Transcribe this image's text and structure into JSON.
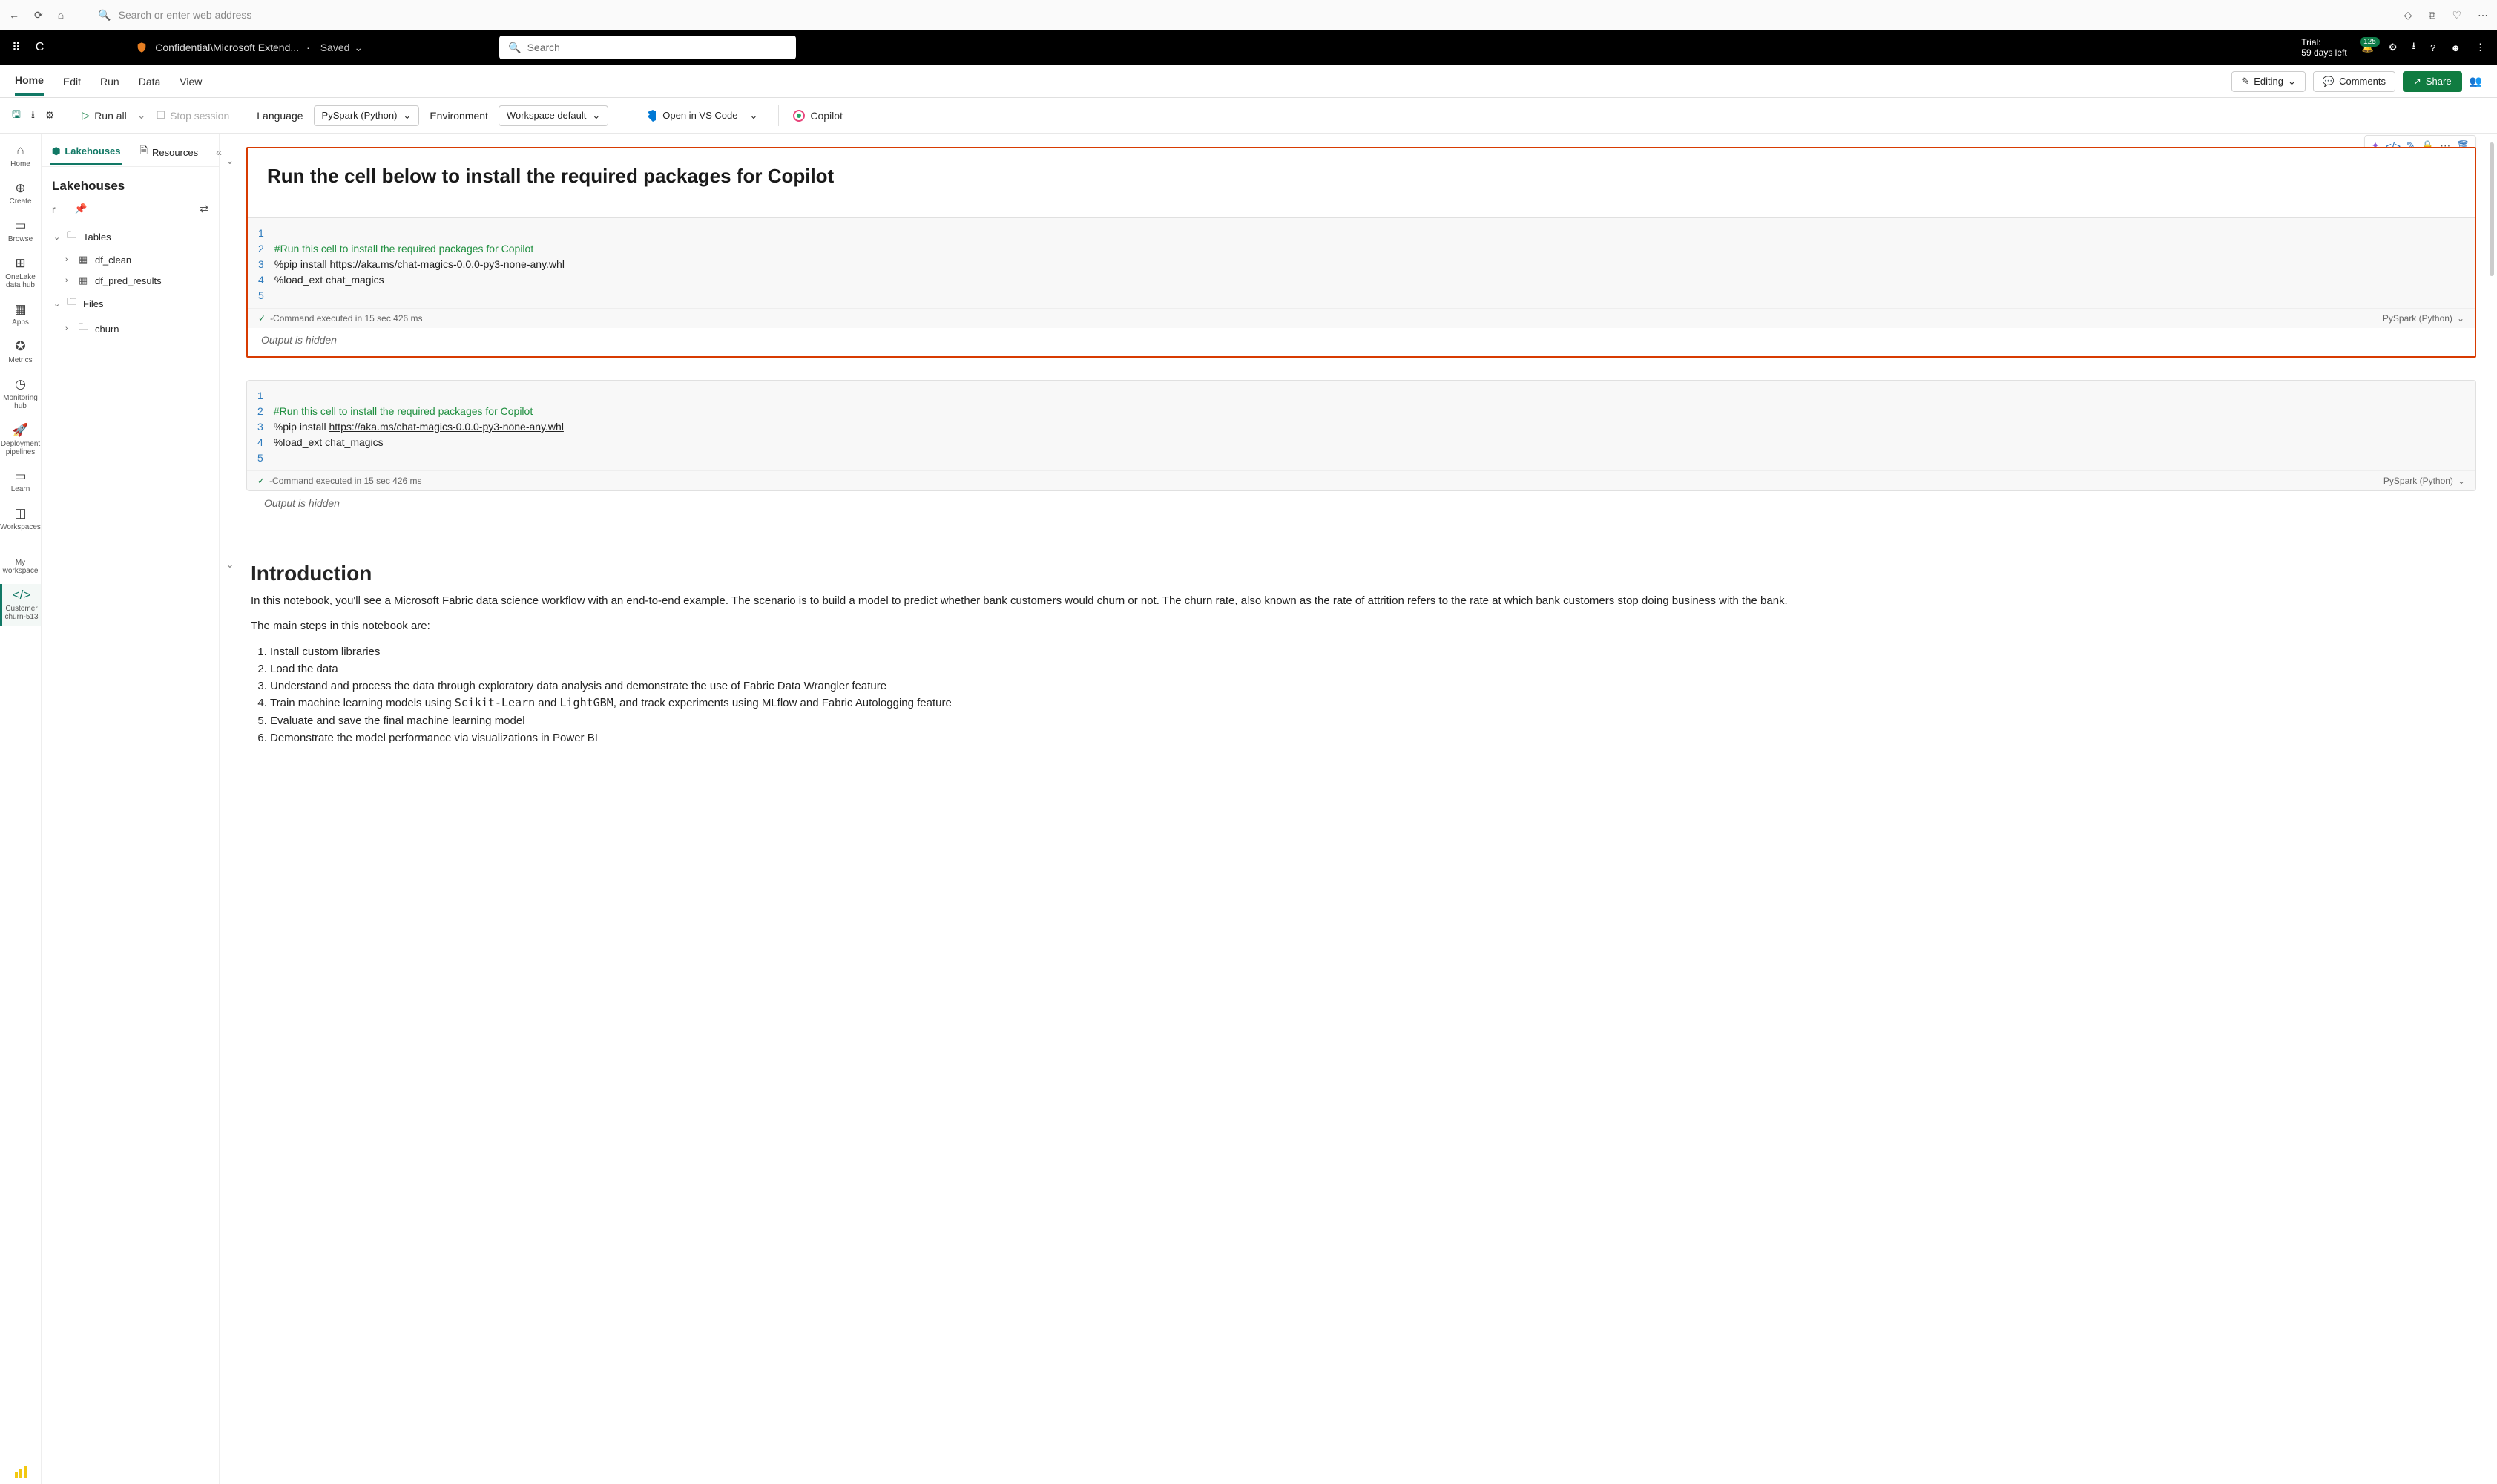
{
  "browser": {
    "placeholder": "Search or enter web address"
  },
  "topbar": {
    "c": "C",
    "breadcrumb": "Confidential\\Microsoft Extend...",
    "saved": "Saved",
    "search_ph": "Search",
    "trial_line1": "Trial:",
    "trial_line2": "59 days left",
    "notif_count": "125"
  },
  "menu": {
    "tabs": [
      "Home",
      "Edit",
      "Run",
      "Data",
      "View"
    ],
    "editing": "Editing",
    "comments": "Comments",
    "share": "Share"
  },
  "toolbar": {
    "run_all": "Run all",
    "stop": "Stop session",
    "language_lbl": "Language",
    "language_val": "PySpark (Python)",
    "env_lbl": "Environment",
    "env_val": "Workspace default",
    "vscode": "Open in VS Code",
    "copilot": "Copilot"
  },
  "leftrail": {
    "items": [
      {
        "icon": "⌂",
        "label": "Home"
      },
      {
        "icon": "＋",
        "label": "Create"
      },
      {
        "icon": "▦",
        "label": "Browse"
      },
      {
        "icon": "◫",
        "label": "OneLake data hub"
      },
      {
        "icon": "▤",
        "label": "Apps"
      },
      {
        "icon": "✪",
        "label": "Metrics"
      },
      {
        "icon": "◷",
        "label": "Monitoring hub"
      },
      {
        "icon": "⟲",
        "label": "Deployment pipelines"
      },
      {
        "icon": "▭",
        "label": "Learn"
      },
      {
        "icon": "◫",
        "label": "Workspaces"
      }
    ],
    "my_workspace": "My workspace",
    "active_nb": "Customer churn-513"
  },
  "sidepanel": {
    "tab1": "Lakehouses",
    "tab2": "Resources",
    "title": "Lakehouses",
    "filter_val": "r",
    "tree": {
      "tables": "Tables",
      "t1": "df_clean",
      "t2": "df_pred_results",
      "files": "Files",
      "f1": "churn"
    }
  },
  "cells": {
    "md1_title": "Run the cell below to install the required packages for Copilot",
    "code": {
      "l2": "#Run this cell to install the required packages for Copilot",
      "l3_a": "%pip install ",
      "l3_url": "https://aka.ms/chat-magics-0.0.0-py3-none-any.whl",
      "l4": "%load_ext chat_magics"
    },
    "status": "-Command executed in 15 sec 426 ms",
    "kernel": "PySpark (Python)",
    "output_hidden": "Output is hidden",
    "intro_h": "Introduction",
    "intro_p1": "In this notebook, you'll see a Microsoft Fabric data science workflow with an end-to-end example. The scenario is to build a model to predict whether bank customers would churn or not. The churn rate, also known as the rate of attrition refers to the rate at which bank customers stop doing business with the bank.",
    "intro_p2": "The main steps in this notebook are:",
    "steps": {
      "s1": "Install custom libraries",
      "s2": "Load the data",
      "s3": "Understand and process the data through exploratory data analysis and demonstrate the use of Fabric Data Wrangler feature",
      "s4_a": "Train machine learning models using ",
      "s4_code1": "Scikit-Learn",
      "s4_b": " and ",
      "s4_code2": "LightGBM",
      "s4_c": ", and track experiments using MLflow and Fabric Autologging feature",
      "s5": "Evaluate and save the final machine learning model",
      "s6": "Demonstrate the model performance via visualizations in Power BI"
    }
  }
}
